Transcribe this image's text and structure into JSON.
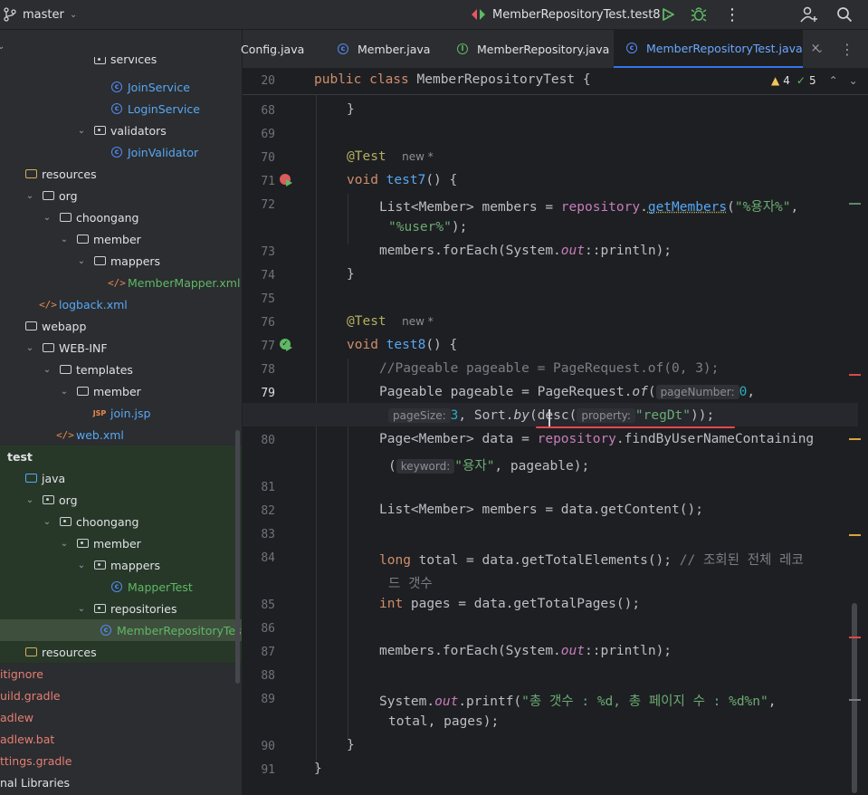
{
  "topbar": {
    "branch": "master",
    "run_config": "MemberRepositoryTest.test8"
  },
  "sidebar": {
    "items": [
      {
        "label": "services",
        "indent": 4,
        "icon": "package-folder",
        "chev": "",
        "color": "",
        "row": "",
        "partial": true
      },
      {
        "label": "JoinService",
        "indent": 5,
        "icon": "class",
        "chev": "",
        "color": "blue",
        "row": ""
      },
      {
        "label": "LoginService",
        "indent": 5,
        "icon": "class",
        "chev": "",
        "color": "blue",
        "row": ""
      },
      {
        "label": "validators",
        "indent": 4,
        "icon": "package-folder",
        "chev": "v",
        "color": "",
        "row": ""
      },
      {
        "label": "JoinValidator",
        "indent": 5,
        "icon": "class",
        "chev": "",
        "color": "blue",
        "row": ""
      },
      {
        "label": "resources",
        "indent": 0,
        "icon": "resources-folder",
        "chev": "",
        "color": "",
        "row": ""
      },
      {
        "label": "org",
        "indent": 1,
        "icon": "folder",
        "chev": "v",
        "color": "",
        "row": ""
      },
      {
        "label": "choongang",
        "indent": 2,
        "icon": "folder",
        "chev": "v",
        "color": "",
        "row": ""
      },
      {
        "label": "member",
        "indent": 3,
        "icon": "folder",
        "chev": "v",
        "color": "",
        "row": ""
      },
      {
        "label": "mappers",
        "indent": 4,
        "icon": "folder",
        "chev": "v",
        "color": "",
        "row": ""
      },
      {
        "label": "MemberMapper.xml",
        "indent": 5,
        "icon": "xml",
        "chev": "",
        "color": "green",
        "row": ""
      },
      {
        "label": "logback.xml",
        "indent": 1,
        "icon": "xml",
        "chev": "",
        "color": "blue",
        "row": ""
      },
      {
        "label": "webapp",
        "indent": 0,
        "icon": "folder",
        "chev": "",
        "color": "",
        "row": ""
      },
      {
        "label": "WEB-INF",
        "indent": 1,
        "icon": "folder",
        "chev": "v",
        "color": "",
        "row": ""
      },
      {
        "label": "templates",
        "indent": 2,
        "icon": "folder",
        "chev": "v",
        "color": "",
        "row": ""
      },
      {
        "label": "member",
        "indent": 3,
        "icon": "folder",
        "chev": "v",
        "color": "",
        "row": ""
      },
      {
        "label": "join.jsp",
        "indent": 4,
        "icon": "jsp",
        "chev": "",
        "color": "blue",
        "row": ""
      },
      {
        "label": "web.xml",
        "indent": 2,
        "icon": "xml",
        "chev": "",
        "color": "blue",
        "row": ""
      },
      {
        "label": "test",
        "indent": 0,
        "icon": "none",
        "chev": "",
        "color": "",
        "row": "green",
        "bold": true
      },
      {
        "label": "java",
        "indent": 0,
        "icon": "source-folder",
        "chev": "",
        "color": "",
        "row": "green"
      },
      {
        "label": "org",
        "indent": 1,
        "icon": "package-folder",
        "chev": "v",
        "color": "",
        "row": "green"
      },
      {
        "label": "choongang",
        "indent": 2,
        "icon": "package-folder",
        "chev": "v",
        "color": "",
        "row": "green"
      },
      {
        "label": "member",
        "indent": 3,
        "icon": "package-folder",
        "chev": "v",
        "color": "",
        "row": "green"
      },
      {
        "label": "mappers",
        "indent": 4,
        "icon": "package-folder",
        "chev": "v",
        "color": "",
        "row": "green"
      },
      {
        "label": "MapperTest",
        "indent": 5,
        "icon": "class",
        "chev": "",
        "color": "green",
        "row": "green"
      },
      {
        "label": "repositories",
        "indent": 4,
        "icon": "package-folder",
        "chev": "v",
        "color": "",
        "row": "green"
      },
      {
        "label": "MemberRepositoryTest",
        "indent": 5,
        "icon": "class",
        "chev": "",
        "color": "green",
        "row": "selected"
      },
      {
        "label": "resources",
        "indent": 0,
        "icon": "resources-folder",
        "chev": "",
        "color": "",
        "row": "green"
      },
      {
        "label": "itignore",
        "indent": 0,
        "icon": "none",
        "chev": "",
        "color": "red",
        "row": ""
      },
      {
        "label": "uild.gradle",
        "indent": 0,
        "icon": "none",
        "chev": "",
        "color": "red",
        "row": ""
      },
      {
        "label": "adlew",
        "indent": 0,
        "icon": "none",
        "chev": "",
        "color": "red",
        "row": ""
      },
      {
        "label": "adlew.bat",
        "indent": 0,
        "icon": "none",
        "chev": "",
        "color": "red",
        "row": ""
      },
      {
        "label": "ttings.gradle",
        "indent": 0,
        "icon": "none",
        "chev": "",
        "color": "red",
        "row": ""
      },
      {
        "label": "nal Libraries",
        "indent": 0,
        "icon": "none",
        "chev": "",
        "color": "",
        "row": ""
      }
    ]
  },
  "tabs": [
    {
      "label": "Config.java",
      "icon": "none"
    },
    {
      "label": "Member.java",
      "icon": "class"
    },
    {
      "label": "MemberRepository.java",
      "icon": "interface"
    },
    {
      "label": "MemberRepositoryTest.java",
      "icon": "class",
      "active": true
    }
  ],
  "editor": {
    "inspections": {
      "warnings": "4",
      "checks": "5"
    },
    "lines": [
      "20",
      "68",
      "69",
      "70",
      "71",
      "72",
      "73",
      "74",
      "75",
      "76",
      "77",
      "78",
      "79",
      "80",
      "81",
      "82",
      "83",
      "84",
      "85",
      "86",
      "87",
      "88",
      "89",
      "90",
      "91"
    ],
    "code": {
      "l20a": "public class ",
      "l20b": "MemberRepositoryTest {",
      "l68": "}",
      "l70a": "@Test",
      "l70b": "new *",
      "l71a": "void ",
      "l71b": "test7",
      "l71c": "() {",
      "l72a": "List<Member> members = ",
      "l72b": "repository",
      "l72c": ".",
      "l72d": "getMembers",
      "l72e": "(",
      "l72f": "\"%용자%\"",
      "l72g": ",",
      "l72h": "\"%user%\"",
      "l72i": ");",
      "l73a": "members.forEach(System.",
      "l73b": "out",
      "l73c": "::println);",
      "l74": "}",
      "l76a": "@Test",
      "l76b": "new *",
      "l77a": "void ",
      "l77b": "test8",
      "l77c": "() {",
      "l78": "//Pageable pageable = PageRequest.of(0, 3);",
      "l79a": "Pageable pageable = PageRequest.",
      "l79b": "of",
      "l79c": "(",
      "l79d": "pageNumber:",
      "l79e": "0",
      "l79f": ",",
      "l79g": "pageSize:",
      "l79h": "3",
      "l79i": ", Sort.",
      "l79j": "by",
      "l79k": "(desc(",
      "l79l": "property:",
      "l79m": "\"regDt\"",
      "l79n": "));",
      "l80a": "Page<Member> data = ",
      "l80b": "repository",
      "l80c": ".findByUserNameContaining",
      "l80d": "(",
      "l80e": "keyword:",
      "l80f": "\"용자\"",
      "l80g": ", pageable);",
      "l82": "List<Member> members = data.getContent();",
      "l84a": "long ",
      "l84b": "total = data.getTotalElements(); ",
      "l84c": "// 조회된 전체 레코",
      "l84d": "드 갯수",
      "l85a": "int ",
      "l85b": "pages = data.getTotalPages();",
      "l87a": "members.forEach(System.",
      "l87b": "out",
      "l87c": "::println);",
      "l89a": "System.",
      "l89b": "out",
      "l89c": ".printf(",
      "l89d": "\"총 갯수 : %d, 총 페이지 수 : %d%n\"",
      "l89e": ",",
      "l89f": "total, pages);",
      "l90": "}",
      "l91": "}"
    }
  }
}
